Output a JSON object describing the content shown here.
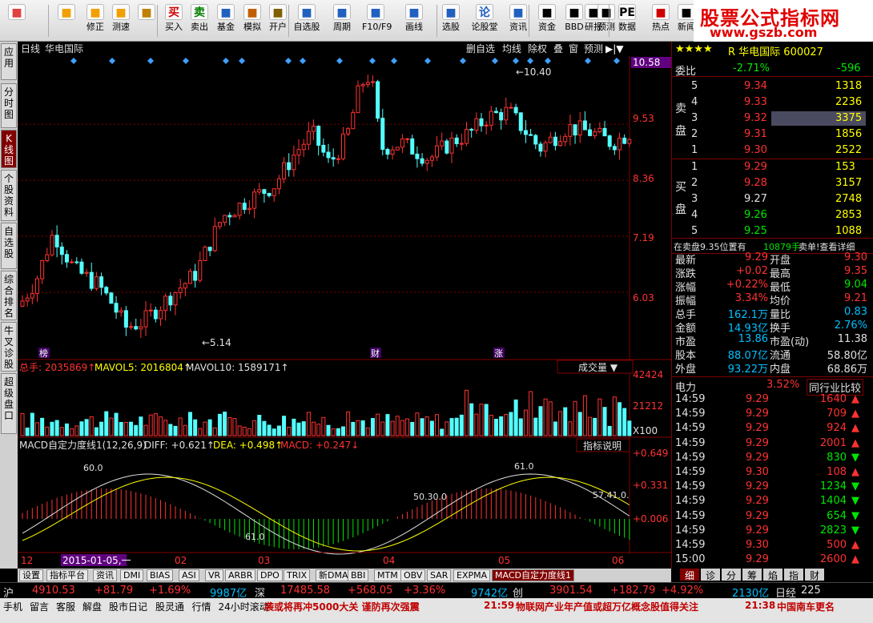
{
  "toolbar": {
    "items": [
      {
        "label": "",
        "icon": "windows-icon",
        "color": "#e04040"
      },
      {
        "label": "",
        "icon": "back-arrow-icon",
        "color": "#f0a000"
      },
      {
        "label": "修正",
        "icon": "arrow-up-icon",
        "color": "#f0a000"
      },
      {
        "label": "测速",
        "icon": "refresh-icon",
        "color": "#f0a000"
      },
      {
        "label": "",
        "icon": "clock-icon",
        "color": "#c08000"
      },
      {
        "label": "买入",
        "icon": "buy-icon",
        "glyph": "买",
        "color": "#d00000"
      },
      {
        "label": "卖出",
        "icon": "sell-icon",
        "glyph": "卖",
        "color": "#008000"
      },
      {
        "label": "基金",
        "icon": "fund-icon",
        "color": "#2060c0"
      },
      {
        "label": "模拟",
        "icon": "hammer-icon",
        "color": "#c06000"
      },
      {
        "label": "开户",
        "icon": "lock-icon",
        "color": "#806000"
      },
      {
        "label": "自选股",
        "icon": "watchlist-icon",
        "color": "#2060c0"
      },
      {
        "label": "周期",
        "icon": "period-icon",
        "color": "#2060c0"
      },
      {
        "label": "F10/F9",
        "icon": "f10-icon",
        "color": "#2060c0"
      },
      {
        "label": "画线",
        "icon": "pencil-icon",
        "color": "#2060c0"
      },
      {
        "label": "选股",
        "icon": "screen-icon",
        "color": "#2060c0"
      },
      {
        "label": "论股堂",
        "icon": "forum-icon",
        "glyph": "论",
        "color": "#2060c0"
      },
      {
        "label": "资讯",
        "icon": "news-icon",
        "color": "#2060c0"
      },
      {
        "label": "资金",
        "icon": "fund-flow-icon",
        "color": "#000"
      },
      {
        "label": "BBD",
        "icon": "bbd-icon",
        "color": "#000"
      },
      {
        "label": "研报",
        "icon": "report-icon",
        "color": "#000"
      },
      {
        "label": "预测",
        "icon": "forecast-icon",
        "color": "#000"
      },
      {
        "label": "数据",
        "icon": "pe-icon",
        "glyph": "PE",
        "color": "#000"
      },
      {
        "label": "热点",
        "icon": "fire-icon",
        "color": "#d00000"
      },
      {
        "label": "新闻",
        "icon": "newspaper-icon",
        "color": "#000"
      }
    ]
  },
  "brand": {
    "title": "股票公式指标网",
    "url": "www.gszb.com"
  },
  "left_tabs": [
    {
      "label": "应用",
      "active": false
    },
    {
      "label": "分时图",
      "active": false
    },
    {
      "label": "K线图",
      "active": true
    },
    {
      "label": "个股资料",
      "active": false
    },
    {
      "label": "自选股",
      "active": false
    },
    {
      "label": "综合排名",
      "active": false
    },
    {
      "label": "牛叉诊股",
      "active": false
    },
    {
      "label": "超级盘口",
      "active": false
    }
  ],
  "chart_header": {
    "period": "日线",
    "name": "华电国际",
    "menu": [
      "删自选",
      "均线",
      "除权",
      "叠",
      "窗",
      "预测"
    ]
  },
  "kline": {
    "right_labels": [
      "10.58",
      "9.53",
      "8.36",
      "7.19",
      "6.03"
    ],
    "high_label": "10.40",
    "low_label": "5.14",
    "markers": [
      "榜",
      "财",
      "涨"
    ]
  },
  "volume": {
    "title_label": "总手:",
    "total": "2035869",
    "mavol5_label": "MAVOL5:",
    "mavol5": "2016804",
    "mavol10_label": "MAVOL10:",
    "mavol10": "1589171",
    "dropdown": "成交量",
    "axis": [
      "42424",
      "21212",
      "X100"
    ]
  },
  "macd": {
    "title": "MACD自定力度线1(12,26,9)",
    "diff_label": "DIFF:",
    "diff": "+0.621",
    "dea_label": "DEA:",
    "dea": "+0.498",
    "macd_label": "MACD:",
    "macd": "+0.247",
    "help": "指标说明",
    "axis": [
      "+0.649",
      "+0.331",
      "+0.006"
    ],
    "annotations": [
      "60.0",
      "61.0",
      "50.30.0",
      "61.0",
      "57.41.0."
    ]
  },
  "x_axis": {
    "labels": [
      "12",
      "2015-01-05,一",
      "02",
      "03",
      "04",
      "05",
      "06"
    ]
  },
  "quote": {
    "title": "R 华电国际 600027",
    "webi_label": "委比",
    "webi": "-2.71%",
    "webi_diff": "-596",
    "sell_label": "卖盘",
    "buy_label": "买盘",
    "asks": [
      {
        "n": "5",
        "price": "9.34",
        "vol": "1318"
      },
      {
        "n": "4",
        "price": "9.33",
        "vol": "2236"
      },
      {
        "n": "3",
        "price": "9.32",
        "vol": "3375"
      },
      {
        "n": "2",
        "price": "9.31",
        "vol": "1856"
      },
      {
        "n": "1",
        "price": "9.30",
        "vol": "2522"
      }
    ],
    "bids": [
      {
        "n": "1",
        "price": "9.29",
        "vol": "153"
      },
      {
        "n": "2",
        "price": "9.28",
        "vol": "3157"
      },
      {
        "n": "3",
        "price": "9.27",
        "vol": "2748"
      },
      {
        "n": "4",
        "price": "9.26",
        "vol": "2853"
      },
      {
        "n": "5",
        "price": "9.25",
        "vol": "1088"
      }
    ],
    "notice": "在卖盘9.35位置有",
    "notice_vol": "10879手",
    "notice_tail": "卖单!查看详细",
    "stats": [
      [
        "最新",
        "9.29",
        "开盘",
        "9.30"
      ],
      [
        "涨跌",
        "+0.02",
        "最高",
        "9.35"
      ],
      [
        "涨幅",
        "+0.22%",
        "最低",
        "9.04"
      ],
      [
        "振幅",
        "3.34%",
        "均价",
        "9.21"
      ],
      [
        "总手",
        "162.1万",
        "量比",
        "0.83"
      ],
      [
        "金额",
        "14.93亿",
        "换手",
        "2.76%"
      ],
      [
        "市盈",
        "13.86",
        "市盈(动)",
        "11.38"
      ],
      [
        "股本",
        "88.07亿",
        "流通",
        "58.80亿"
      ],
      [
        "外盘",
        "93.22万",
        "内盘",
        "68.86万"
      ]
    ],
    "industry": "电力",
    "industry_pct": "3.52%",
    "industry_btn": "同行业比较",
    "ticks": [
      [
        "14:59",
        "9.29",
        "1640",
        "up"
      ],
      [
        "14:59",
        "9.29",
        "709",
        "up"
      ],
      [
        "14:59",
        "9.29",
        "924",
        "up"
      ],
      [
        "14:59",
        "9.29",
        "2001",
        "up"
      ],
      [
        "14:59",
        "9.29",
        "830",
        "down"
      ],
      [
        "14:59",
        "9.30",
        "108",
        "up"
      ],
      [
        "14:59",
        "9.29",
        "1234",
        "down"
      ],
      [
        "14:59",
        "9.29",
        "1404",
        "down"
      ],
      [
        "14:59",
        "9.29",
        "654",
        "down"
      ],
      [
        "14:59",
        "9.29",
        "2823",
        "down"
      ],
      [
        "14:59",
        "9.30",
        "500",
        "up"
      ],
      [
        "15:00",
        "9.29",
        "2600",
        "up"
      ]
    ],
    "tabs": [
      "细",
      "诊",
      "分",
      "筹",
      "焰",
      "指",
      "财"
    ]
  },
  "bottom_tabs": [
    "设置",
    "指标平台",
    "资讯",
    "DMI",
    "BIAS",
    "ASI",
    "VR",
    "ARBR",
    "DPO",
    "TRIX",
    "新DMA",
    "BBI",
    "MTM",
    "OBV",
    "SAR",
    "EXPMA",
    "MACD自定力度线1"
  ],
  "status": {
    "hu_label": "沪",
    "hu": "4910.53",
    "hu_chg": "+81.79",
    "hu_pct": "+1.69%",
    "hu_amt": "9987亿",
    "shen_label": "深",
    "shen": "17485.58",
    "shen_chg": "+568.05",
    "shen_pct": "+3.36%",
    "shen_amt": "9742亿",
    "chuang_label": "创",
    "chuang": "3901.54",
    "chuang_chg": "+182.79",
    "chuang_pct": "+4.92%",
    "chuang_amt": "2130亿",
    "rijing_label": "日经",
    "rijing": "225"
  },
  "status2": {
    "items": [
      "手机",
      "留言",
      "客服",
      "解盘",
      "股市日记",
      "股灵通",
      "行情",
      "24小时滚动"
    ],
    "news1": "袭或将再冲5000大关 谨防再次强震",
    "news2_time": "21:59",
    "news2": "物联网产业年产值或超万亿概念股值得关注",
    "news3_time": "21:38",
    "news3": "中国南车更名"
  },
  "chart_data": {
    "type": "candlestick",
    "series_count": 2,
    "price_range": [
      5.0,
      10.6
    ],
    "x_labels": [
      "12",
      "2015-01-05",
      "02",
      "03",
      "04",
      "05",
      "06"
    ]
  }
}
